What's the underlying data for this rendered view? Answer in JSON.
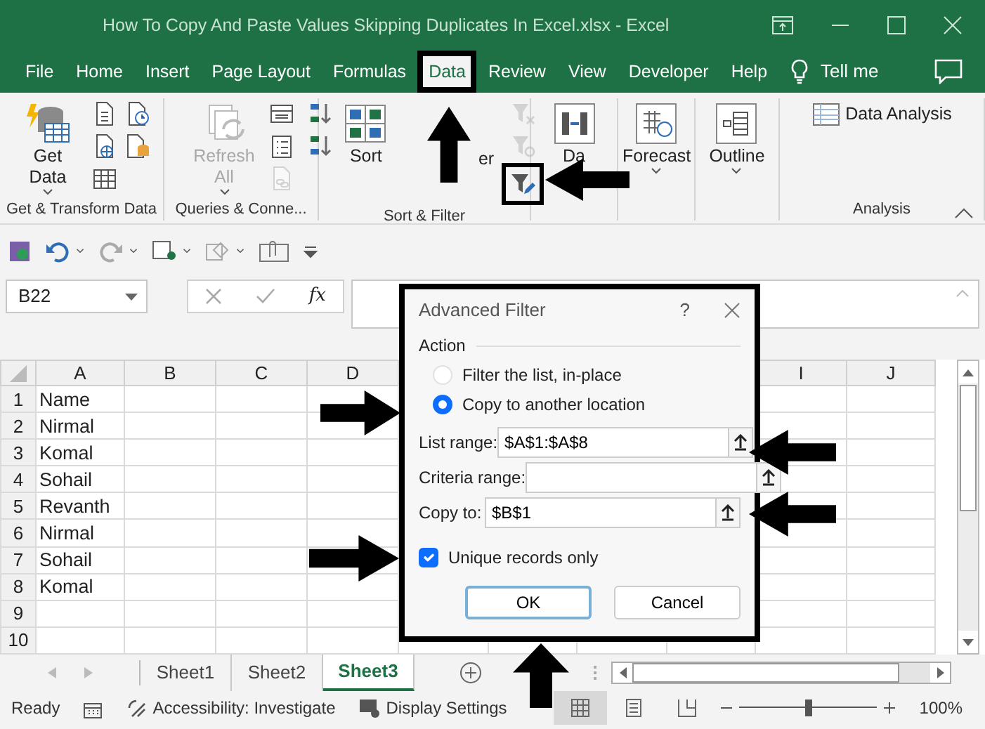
{
  "window": {
    "title": "How To Copy And Paste Values Skipping Duplicates In Excel.xlsx  -  Excel"
  },
  "tabs": [
    {
      "label": "File",
      "selected": false,
      "highlighted": false
    },
    {
      "label": "Home",
      "selected": false,
      "highlighted": false
    },
    {
      "label": "Insert",
      "selected": false,
      "highlighted": false
    },
    {
      "label": "Page Layout",
      "selected": false,
      "highlighted": false
    },
    {
      "label": "Formulas",
      "selected": false,
      "highlighted": false
    },
    {
      "label": "Data",
      "selected": true,
      "highlighted": true
    },
    {
      "label": "Review",
      "selected": false,
      "highlighted": false
    },
    {
      "label": "View",
      "selected": false,
      "highlighted": false
    },
    {
      "label": "Developer",
      "selected": false,
      "highlighted": false
    },
    {
      "label": "Help",
      "selected": false,
      "highlighted": false
    }
  ],
  "tell_me": "Tell me",
  "ribbon": {
    "groups": [
      {
        "label": "Get & Transform Data",
        "items": [
          {
            "kind": "large",
            "label": "Get Data",
            "dropdown": true,
            "disabled": false
          },
          {
            "kind": "stack",
            "icons": [
              {
                "disabled": false,
                "highlighted": false
              },
              {
                "disabled": false,
                "highlighted": false
              },
              {
                "disabled": false,
                "highlighted": false
              }
            ]
          },
          {
            "kind": "stack",
            "icons": [
              {
                "disabled": false,
                "highlighted": false
              },
              {
                "disabled": false,
                "highlighted": false
              }
            ]
          }
        ]
      },
      {
        "label": "Queries & Conne...",
        "items": [
          {
            "kind": "large",
            "label": "Refresh All",
            "dropdown": true,
            "disabled": true
          },
          {
            "kind": "stack",
            "icons": [
              {
                "disabled": false,
                "highlighted": false
              },
              {
                "disabled": false,
                "highlighted": false
              },
              {
                "disabled": true,
                "highlighted": false
              }
            ]
          }
        ]
      },
      {
        "label": "Sort & Filter",
        "items": [
          {
            "kind": "stack",
            "icons": [
              {
                "disabled": false,
                "highlighted": false
              },
              {
                "disabled": false,
                "highlighted": false
              }
            ]
          },
          {
            "kind": "large",
            "label": "Sort",
            "dropdown": false,
            "disabled": false
          },
          {
            "kind": "large",
            "label": "er",
            "dropdown": false,
            "disabled": false
          },
          {
            "kind": "stack",
            "icons": [
              {
                "disabled": true,
                "highlighted": false
              },
              {
                "disabled": true,
                "highlighted": false
              },
              {
                "disabled": false,
                "highlighted": true
              }
            ]
          }
        ]
      },
      {
        "items": [
          {
            "kind": "large",
            "label": "Da",
            "dropdown": false,
            "disabled": false
          }
        ]
      },
      {
        "items": [
          {
            "kind": "large",
            "label": "Forecast",
            "dropdown": true,
            "disabled": false
          }
        ]
      },
      {
        "items": [
          {
            "kind": "large",
            "label": "Outline",
            "dropdown": true,
            "disabled": false
          }
        ]
      },
      {
        "label": "Analysis",
        "items": [
          {
            "kind": "row",
            "label": "Data Analysis",
            "dropdown": false,
            "disabled": false
          }
        ]
      }
    ]
  },
  "formula_bar": {
    "name_box": "B22",
    "function_label": "fx"
  },
  "sheet": {
    "columns": [
      {
        "label": "A"
      },
      {
        "label": "B"
      },
      {
        "label": "C"
      },
      {
        "label": "D"
      },
      {},
      {},
      {},
      {},
      {
        "label": "I"
      },
      {
        "label": "J"
      }
    ],
    "rows": [
      {
        "number": "1",
        "cells": [
          "Name"
        ]
      },
      {
        "number": "2",
        "cells": [
          "Nirmal"
        ]
      },
      {
        "number": "3",
        "cells": [
          "Komal"
        ]
      },
      {
        "number": "4",
        "cells": [
          "Sohail"
        ]
      },
      {
        "number": "5",
        "cells": [
          "Revanth"
        ]
      },
      {
        "number": "6",
        "cells": [
          "Nirmal"
        ]
      },
      {
        "number": "7",
        "cells": [
          "Sohail"
        ]
      },
      {
        "number": "8",
        "cells": [
          "Komal"
        ]
      },
      {
        "number": "9"
      },
      {
        "number": "10"
      }
    ]
  },
  "sheet_tabs": [
    {
      "label": "Sheet1",
      "selected": false
    },
    {
      "label": "Sheet2",
      "selected": false
    },
    {
      "label": "Sheet3",
      "selected": true
    }
  ],
  "status_bar": {
    "status": "Ready",
    "accessibility": "Accessibility: Investigate",
    "display_settings": "Display Settings",
    "views": [
      {
        "selected": true
      },
      {
        "selected": false
      },
      {
        "selected": false
      }
    ],
    "zoom": {
      "level": 0.5,
      "reading": "100%"
    }
  },
  "dialog": {
    "title": "Advanced Filter",
    "help": "?",
    "highlighted": true,
    "section": "Action",
    "options": [
      {
        "label": "Filter the list, in-place",
        "selected": false
      },
      {
        "label": "Copy to another location",
        "selected": true
      }
    ],
    "fields": [
      {
        "label": "List range:",
        "value": "$A$1:$A$8"
      },
      {
        "label": "Criteria range:"
      },
      {
        "label": "Copy to:",
        "value": "$B$1"
      }
    ],
    "unique": {
      "label": "Unique records only",
      "checked": true
    },
    "buttons": [
      {
        "label": "OK",
        "default": true
      },
      {
        "label": "Cancel",
        "default": false
      }
    ]
  },
  "annotations": [
    {
      "kind": "arrow"
    },
    {
      "kind": "arrow"
    },
    {
      "kind": "arrow"
    },
    {
      "kind": "arrow"
    },
    {
      "kind": "arrow"
    },
    {
      "kind": "arrow"
    },
    {
      "kind": "arrow"
    }
  ]
}
